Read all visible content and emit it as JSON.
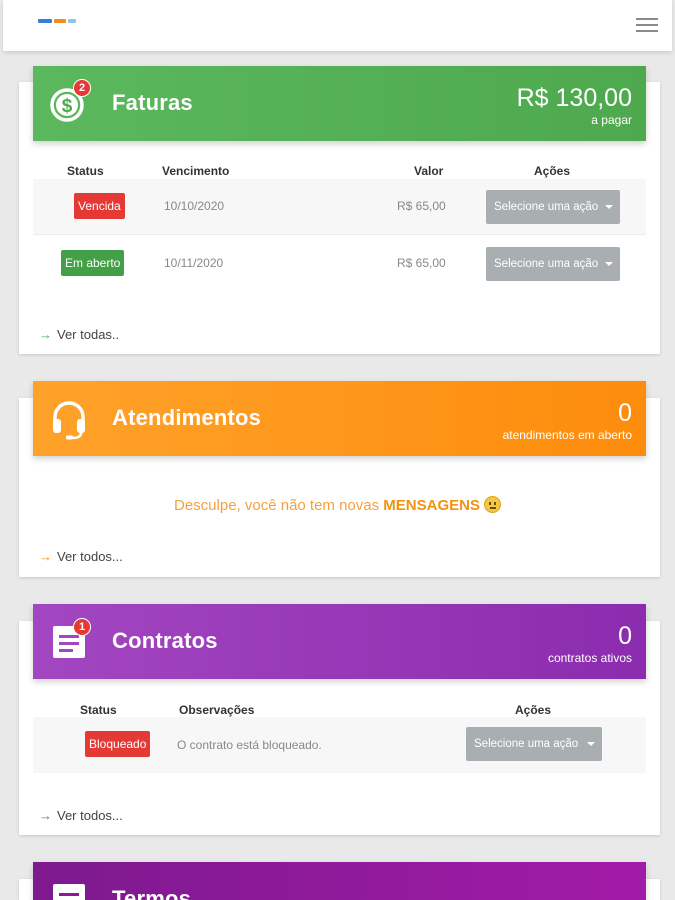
{
  "colors": {
    "green": "#4ea94e",
    "orange": "#fd8c0c",
    "purple": "#8b2cae",
    "violet": "#8e1a9a",
    "red_status": "#e53935",
    "green_status": "#43a047"
  },
  "faturas": {
    "title": "Faturas",
    "badge": "2",
    "icon": "dollar-icon",
    "amount": "R$ 130,00",
    "amount_sub": "a pagar",
    "headers": {
      "status": "Status",
      "due": "Vencimento",
      "value": "Valor",
      "actions": "Ações"
    },
    "rows": [
      {
        "status": "Vencida",
        "due": "10/10/2020",
        "value": "R$ 65,00",
        "action": "Selecione uma ação"
      },
      {
        "status": "Em aberto",
        "due": "10/11/2020",
        "value": "R$ 65,00",
        "action": "Selecione uma ação"
      }
    ],
    "see_all": "Ver todas.."
  },
  "atendimentos": {
    "title": "Atendimentos",
    "icon": "headset-icon",
    "count": "0",
    "count_sub": "atendimentos em aberto",
    "empty_prefix": "Desculpe, você não tem novas",
    "empty_strong": "MENSAGENS",
    "see_all": "Ver todos..."
  },
  "contratos": {
    "title": "Contratos",
    "badge": "1",
    "icon": "document-icon",
    "count": "0",
    "count_sub": "contratos ativos",
    "headers": {
      "status": "Status",
      "notes": "Observações",
      "actions": "Ações"
    },
    "rows": [
      {
        "status": "Bloqueado",
        "notes": "O contrato está bloqueado.",
        "action": "Selecione uma ação"
      }
    ],
    "see_all": "Ver todos..."
  },
  "termos": {
    "title": "Termos",
    "icon": "document-icon"
  }
}
